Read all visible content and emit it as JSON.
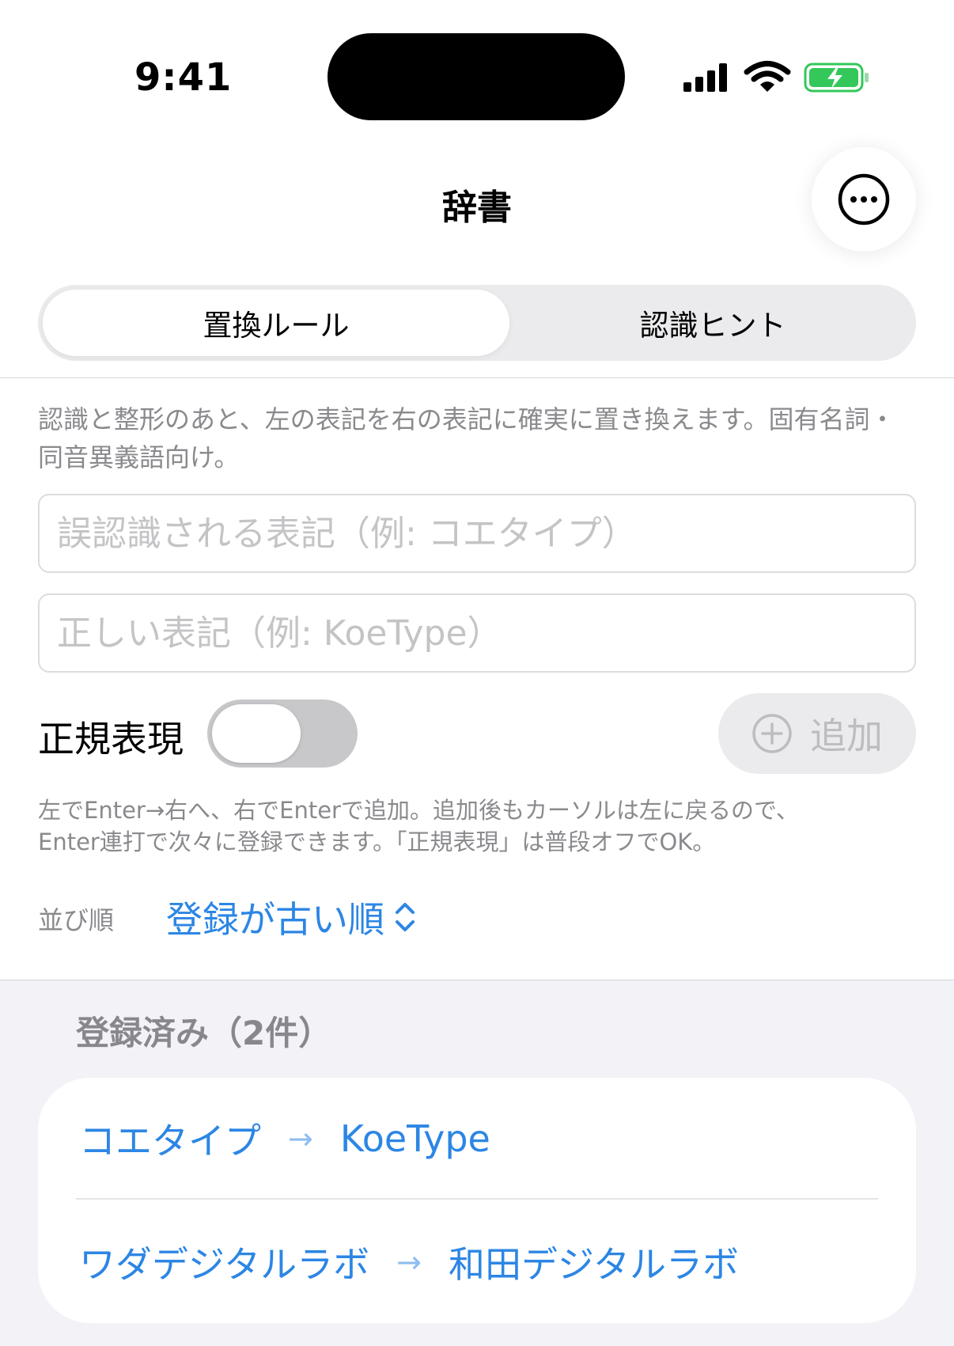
{
  "status_bar": {
    "time": "9:41",
    "icons": [
      "cellular-signal-icon",
      "wifi-icon",
      "battery-charging-icon"
    ],
    "battery_color": "#34c759"
  },
  "nav": {
    "title": "辞書",
    "more_icon": "ellipsis-circle-icon"
  },
  "tabs": [
    {
      "label": "置換ルール",
      "selected": true
    },
    {
      "label": "認識ヒント",
      "selected": false
    }
  ],
  "description": "認識と整形のあと、左の表記を右の表記に確実に置き換えます。固有名詞・同音異義語向け。",
  "form": {
    "wrong_placeholder": "誤認識される表記（例: コエタイプ）",
    "wrong_value": "",
    "correct_placeholder": "正しい表記（例: KoeType）",
    "correct_value": "",
    "regex_label": "正規表現",
    "regex_enabled": false,
    "add_label": "追加",
    "add_icon": "plus-circle-icon",
    "add_enabled": false
  },
  "helper_text_line1": "左でEnter→右へ、右でEnterで追加。追加後もカーソルは左に戻るので、",
  "helper_text_line2": "Enter連打で次々に登録できます。「正規表現」は普段オフでOK。",
  "sort": {
    "label": "並び順",
    "value": "登録が古い順",
    "icon": "chevron-up-down-icon"
  },
  "list": {
    "header": "登録済み（2件）",
    "items": [
      {
        "from": "コエタイプ",
        "to": "KoeType"
      },
      {
        "from": "ワダデジタルラボ",
        "to": "和田デジタルラボ"
      }
    ],
    "arrow": "→"
  },
  "colors": {
    "accent": "#2c86e4",
    "secondary_text": "#8a8a8e",
    "list_background": "#f2f2f7"
  }
}
